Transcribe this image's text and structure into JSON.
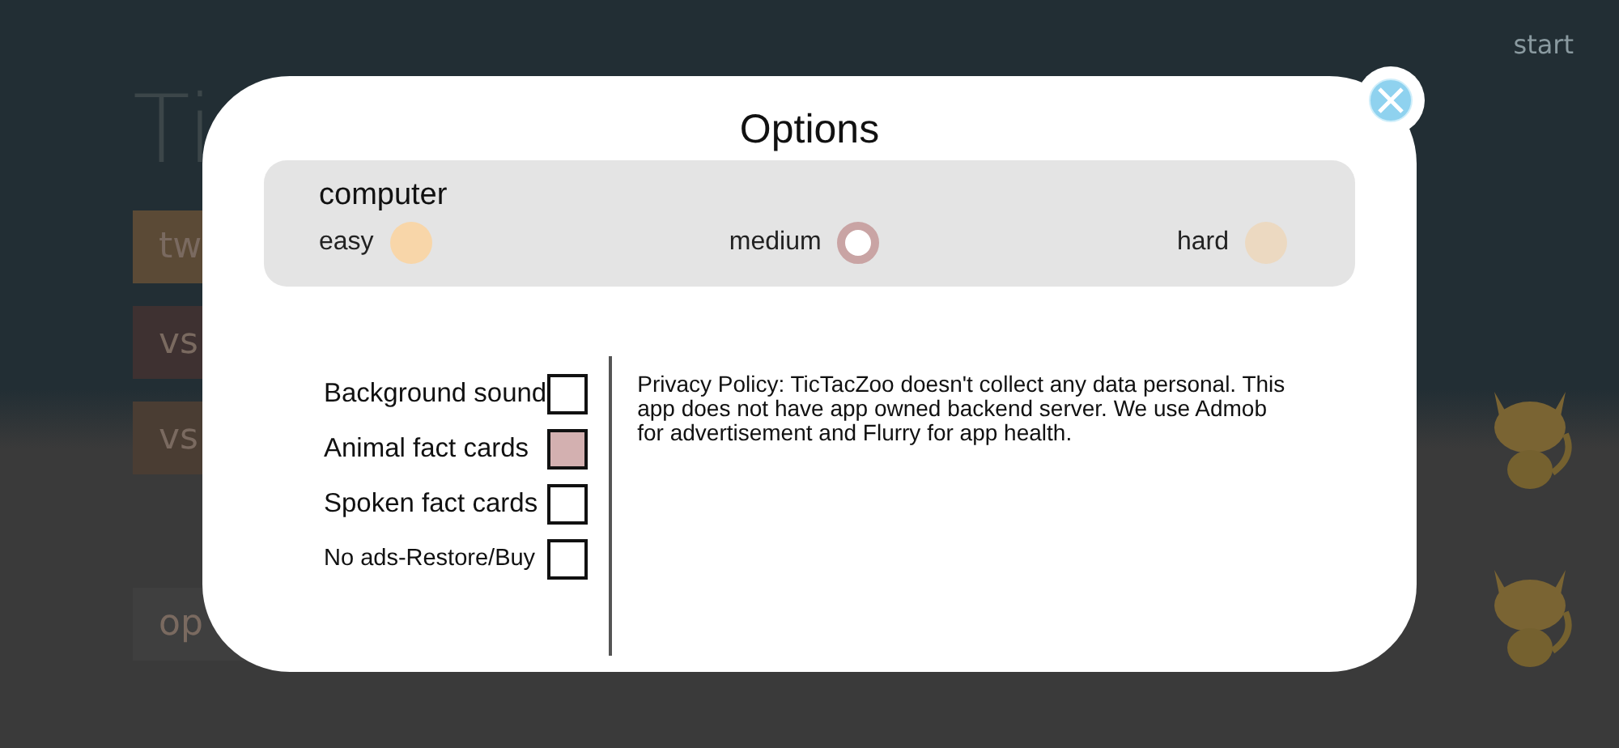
{
  "background": {
    "title": "Ti",
    "start": "start",
    "buttons": [
      {
        "label": "tw",
        "color": "#5b4a36"
      },
      {
        "label": "vs",
        "color": "#3e3131"
      },
      {
        "label": "vs",
        "color": "#4a3d33"
      },
      {
        "label": "op",
        "color": "#3f3f3f"
      }
    ]
  },
  "dialog": {
    "title": "Options",
    "difficulty": {
      "label": "computer",
      "options": [
        {
          "label": "easy",
          "selected": false,
          "color": "#f8d6a9"
        },
        {
          "label": "medium",
          "selected": true,
          "color": "#c9a4a4"
        },
        {
          "label": "hard",
          "selected": false,
          "color": "#ecd9c1"
        }
      ]
    },
    "settings": [
      {
        "label": "Background sound",
        "checked": false
      },
      {
        "label": "Animal fact cards",
        "checked": true
      },
      {
        "label": "Spoken fact cards",
        "checked": false
      },
      {
        "label": "No ads-Restore/Buy",
        "checked": false
      }
    ],
    "privacy": "Privacy Policy: TicTacZoo doesn't collect any data personal. This app does not have app owned backend server. We use Admob for advertisement and Flurry for app health."
  }
}
